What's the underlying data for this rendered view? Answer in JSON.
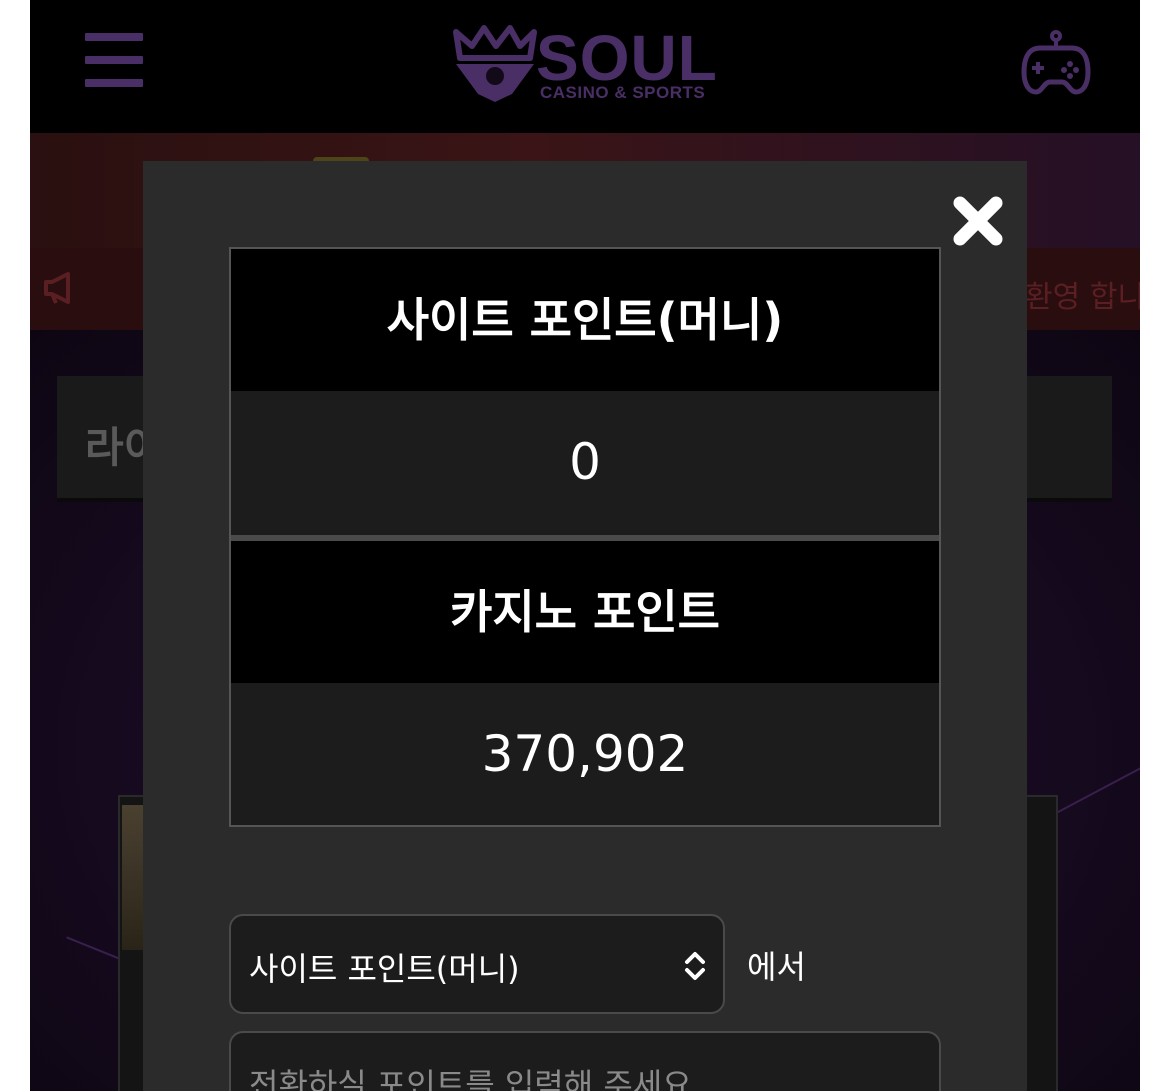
{
  "header": {
    "logo_title": "SOUL",
    "logo_subtitle": "CASINO & SPORTS"
  },
  "notice": {
    "text": "환영 합니"
  },
  "section": {
    "title_partial": "라이"
  },
  "modal": {
    "site_point_header": "사이트 포인트(머니)",
    "site_point_value": "0",
    "casino_point_header": "카지노 포인트",
    "casino_point_value": "370,902",
    "source_select_value": "사이트 포인트(머니)",
    "from_suffix": "에서",
    "amount_placeholder": "전환하실 포인트를 입력해 주세요"
  },
  "colors": {
    "accent_purple": "#4a2e66",
    "modal_bg": "#2b2b2b",
    "header_row_bg": "#000000"
  },
  "icons": [
    "menu-icon",
    "crown-logo-icon",
    "gamepad-icon",
    "megaphone-icon",
    "close-icon",
    "select-arrows-icon"
  ]
}
